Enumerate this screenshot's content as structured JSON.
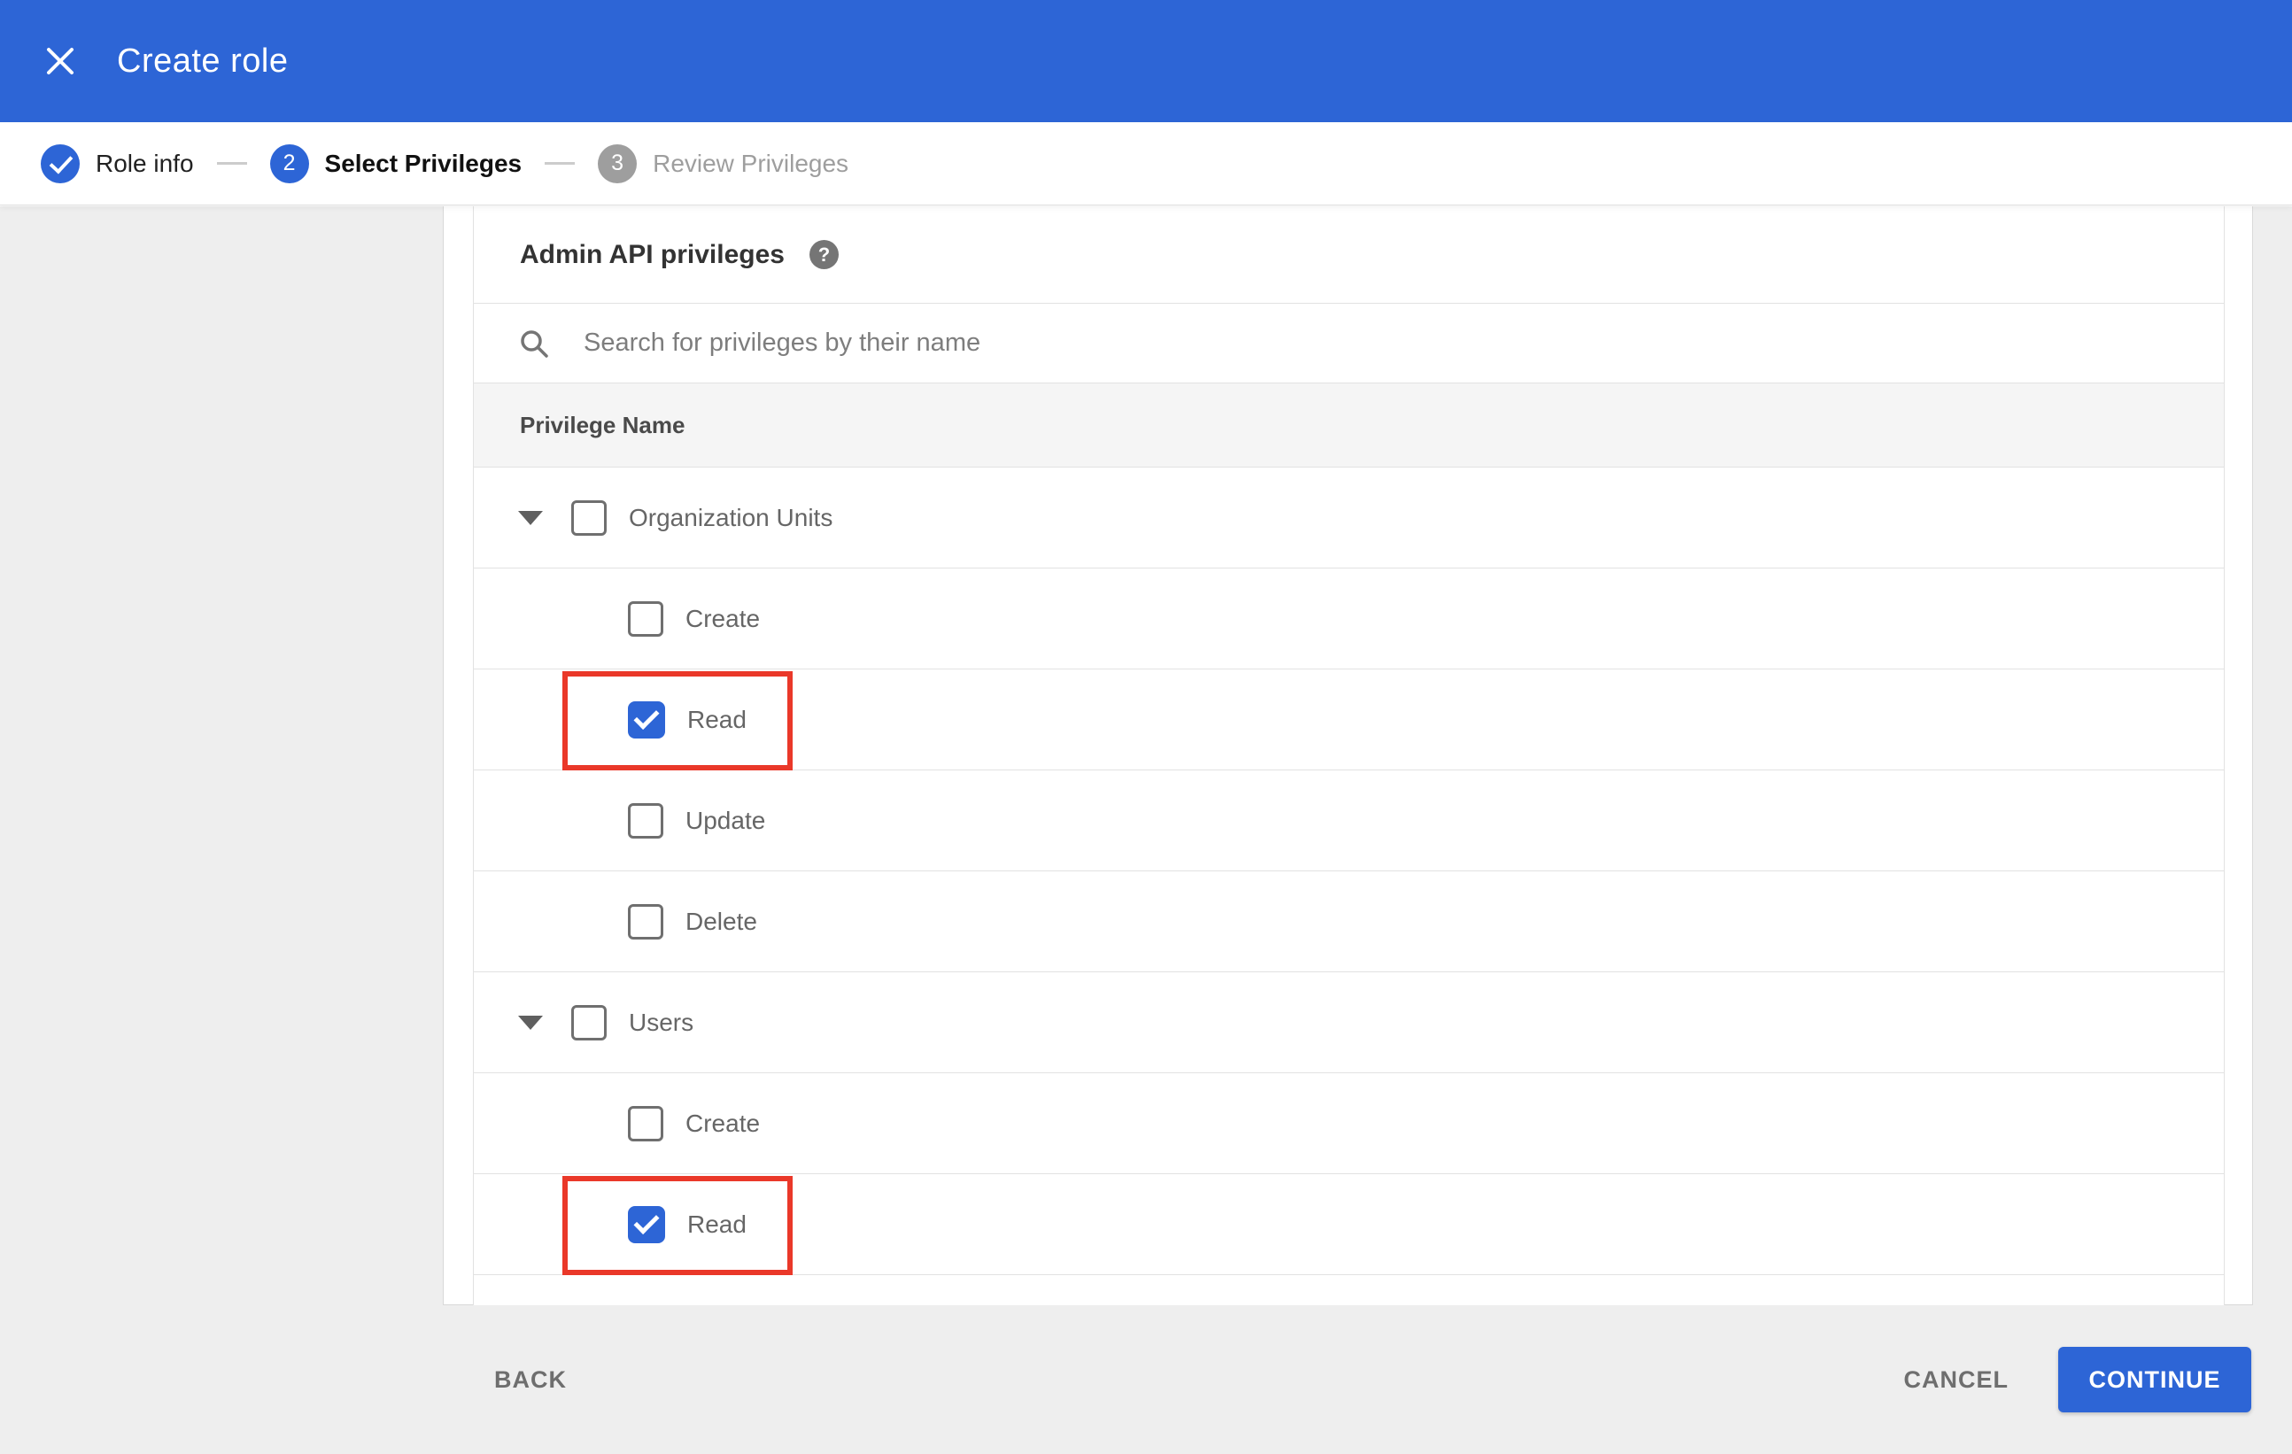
{
  "header": {
    "title": "Create role"
  },
  "stepper": {
    "steps": [
      {
        "label": "Role info",
        "state": "done",
        "indicator": "check"
      },
      {
        "label": "Select Privileges",
        "state": "active",
        "indicator": "2"
      },
      {
        "label": "Review Privileges",
        "state": "upcoming",
        "indicator": "3"
      }
    ]
  },
  "content": {
    "heading": "Admin API privileges",
    "help_icon": "?",
    "search_placeholder": "Search for privileges by their name",
    "table_header": "Privilege Name",
    "groups": [
      {
        "label": "Organization Units",
        "checked": false,
        "expanded": true,
        "children": [
          {
            "label": "Create",
            "checked": false,
            "highlighted": false
          },
          {
            "label": "Read",
            "checked": true,
            "highlighted": true
          },
          {
            "label": "Update",
            "checked": false,
            "highlighted": false
          },
          {
            "label": "Delete",
            "checked": false,
            "highlighted": false
          }
        ]
      },
      {
        "label": "Users",
        "checked": false,
        "expanded": true,
        "children": [
          {
            "label": "Create",
            "checked": false,
            "highlighted": false
          },
          {
            "label": "Read",
            "checked": true,
            "highlighted": true
          }
        ]
      }
    ]
  },
  "footer": {
    "back": "BACK",
    "cancel": "CANCEL",
    "continue": "CONTINUE"
  },
  "colors": {
    "accent_blue": "#2d65d6",
    "highlight_red": "#ea3829",
    "page_gray": "#eeeeee"
  }
}
